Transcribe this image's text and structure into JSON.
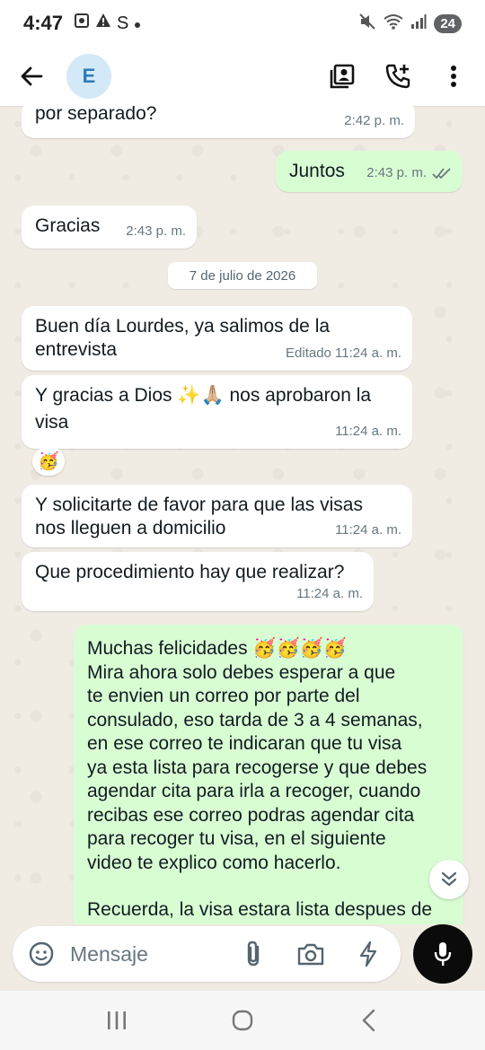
{
  "status_bar": {
    "time": "4:47",
    "s_glyph": "S",
    "battery": "24"
  },
  "header": {
    "avatar_letter": "E"
  },
  "messages": [
    {
      "text": "por separado?",
      "time": "2:42 p. m.",
      "direction": "in"
    },
    {
      "text": "Juntos",
      "time": "2:43 p. m.",
      "direction": "out",
      "read": true
    },
    {
      "text": "Gracias",
      "time": "2:43 p. m.",
      "direction": "in"
    },
    {
      "text_line1": "Buen día Lourdes, ya salimos de la",
      "text_line2": "entrevista",
      "time": "Editado 11:24 a. m.",
      "direction": "in"
    },
    {
      "text_line1": "Y gracias a Dios ✨🙏🏼 nos aprobaron la",
      "text_line2": "visa",
      "time": "11:24 a. m.",
      "direction": "in",
      "reaction": "🥳"
    },
    {
      "text_line1": "Y solicitarte de favor para que las visas",
      "text_line2": "nos lleguen a domicilio",
      "time": "11:24 a. m.",
      "direction": "in"
    },
    {
      "text": "Que procedimiento hay que realizar?",
      "time": "11:24 a. m.",
      "direction": "in"
    },
    {
      "direction": "out",
      "lines": [
        "Muchas felicidades 🥳🥳🥳🥳",
        "Mira ahora solo debes esperar a que",
        "te envien un correo por parte del",
        "consulado, eso tarda de 3 a 4 semanas,",
        "en ese correo te indicaran que tu visa",
        "ya esta lista para recogerse y que debes",
        "agendar cita para irla a recoger, cuando",
        "recibas ese correo podras agendar cita",
        "para recoger tu visa, en el siguiente",
        "video te explico como hacerlo.",
        "",
        "Recuerda, la visa estara lista despues de"
      ]
    }
  ],
  "date_divider": "7 de julio de 2026",
  "composer": {
    "placeholder": "Mensaje"
  },
  "colors": {
    "incoming": "#ffffff",
    "outgoing": "#d9fdd3",
    "wallpaper": "#f0ebe3",
    "read_tick": "#667781"
  }
}
